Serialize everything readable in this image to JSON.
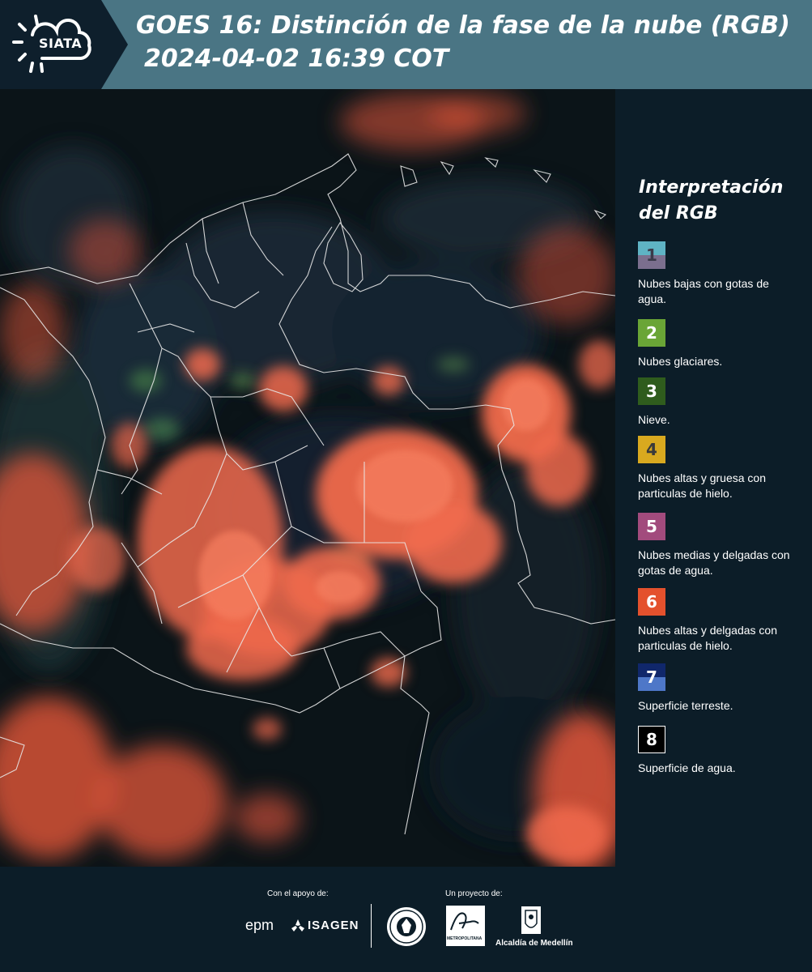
{
  "header": {
    "logo_text": "SIATA",
    "title_line1": "GOES 16: Distinción de la fase de la nube (RGB)",
    "title_line2": "2024-04-02 16:39 COT"
  },
  "legend": {
    "title_line1": "Interpretación",
    "title_line2": "del RGB",
    "items": [
      {
        "num": "1",
        "label": "Nubes bajas con gotas de agua.",
        "color_top": "#5fb3c4",
        "color_bottom": "#7b6f8e",
        "num_color": "#3a3a4a"
      },
      {
        "num": "2",
        "label": "Nubes glaciares.",
        "color_top": "#6aa536",
        "color_bottom": "#6aa536",
        "num_color": "#ffffff"
      },
      {
        "num": "3",
        "label": "Nieve.",
        "color_top": "#2f5c1d",
        "color_bottom": "#2f5c1d",
        "num_color": "#ffffff"
      },
      {
        "num": "4",
        "label": "Nubes altas y gruesa con particulas de hielo.",
        "color_top": "#d9a91f",
        "color_bottom": "#d9a91f",
        "num_color": "#3a3a3a"
      },
      {
        "num": "5",
        "label": "Nubes medias y delgadas con gotas de agua.",
        "color_top": "#a24b7d",
        "color_bottom": "#a24b7d",
        "num_color": "#ffffff"
      },
      {
        "num": "6",
        "label": "Nubes altas y delgadas con particulas de hielo.",
        "color_top": "#e4512d",
        "color_bottom": "#e4512d",
        "num_color": "#ffffff"
      },
      {
        "num": "7",
        "label": "Superficie terreste.",
        "color_top": "#10276b",
        "color_bottom": "#4e77c8",
        "num_color": "#ffffff"
      },
      {
        "num": "8",
        "label": "Superficie de agua.",
        "color_top": "#000000",
        "color_bottom": "#000000",
        "num_color": "#ffffff"
      }
    ]
  },
  "footer": {
    "support_label": "Con el apoyo de:",
    "project_label": "Un proyecto de:",
    "epm": "epm",
    "isagen": "ISAGEN",
    "area_sub": "METROPOLITANA",
    "alcaldia": "Alcaldía de Medellín"
  }
}
